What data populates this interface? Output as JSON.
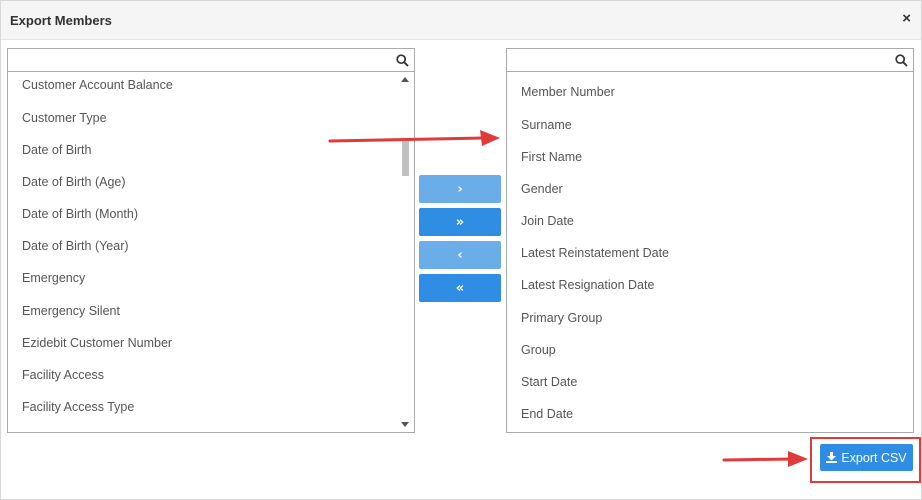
{
  "dialog": {
    "title": "Export Members",
    "close_label": "×"
  },
  "left_panel": {
    "search_value": "",
    "items": [
      "Customer Account Balance",
      "Customer Type",
      "Date of Birth",
      "Date of Birth (Age)",
      "Date of Birth (Month)",
      "Date of Birth (Year)",
      "Emergency",
      "Emergency Silent",
      "Ezidebit Customer Number",
      "Facility Access",
      "Facility Access Type"
    ]
  },
  "right_panel": {
    "search_value": "",
    "items": [
      "Member Number",
      "Surname",
      "First Name",
      "Gender",
      "Join Date",
      "Latest Reinstatement Date",
      "Latest Resignation Date",
      "Primary Group",
      "Group",
      "Start Date",
      "End Date"
    ]
  },
  "transfer_buttons": {
    "move_one_right": "›",
    "move_all_right": "»",
    "move_one_left": "‹",
    "move_all_left": "«"
  },
  "export_button": {
    "label": "Export CSV",
    "icon": "download-icon"
  },
  "colors": {
    "accent": "#2f8ee3",
    "accent_light": "#6aade8",
    "annotation": "#e03a3a"
  },
  "annotations": [
    "arrow-to-selected-list",
    "arrow-to-export-button"
  ]
}
